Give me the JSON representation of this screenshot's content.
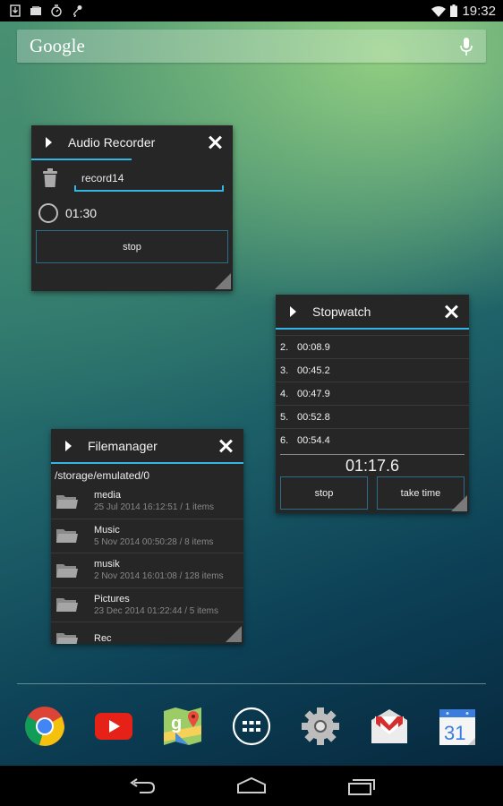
{
  "statusbar": {
    "left_icons": [
      "download-icon",
      "folder-icon",
      "stopwatch-icon",
      "microphone-icon"
    ],
    "right_icons": [
      "wifi-icon",
      "battery-icon"
    ],
    "time": "19:32"
  },
  "search": {
    "logo": "Google",
    "mic_icon": "microphone-icon"
  },
  "audio_recorder": {
    "title": "Audio Recorder",
    "filename": "record14",
    "elapsed": "01:30",
    "stop_label": "stop"
  },
  "stopwatch": {
    "title": "Stopwatch",
    "laps": [
      {
        "num": "2.",
        "time": "00:08.9"
      },
      {
        "num": "3.",
        "time": "00:45.2"
      },
      {
        "num": "4.",
        "time": "00:47.9"
      },
      {
        "num": "5.",
        "time": "00:52.8"
      },
      {
        "num": "6.",
        "time": "00:54.4"
      }
    ],
    "total": "01:17.6",
    "stop_label": "stop",
    "take_time_label": "take time"
  },
  "filemanager": {
    "title": "Filemanager",
    "path": "/storage/emulated/0",
    "items": [
      {
        "name": "media",
        "meta": "25 Jul 2014 16:12:51 / 1 items"
      },
      {
        "name": "Music",
        "meta": "5 Nov 2014 00:50:28 / 8 items"
      },
      {
        "name": "musik",
        "meta": "2 Nov 2014 16:01:08 / 128 items"
      },
      {
        "name": "Pictures",
        "meta": "23 Dec 2014 01:22:44 / 5 items"
      },
      {
        "name": "Rec",
        "meta": ""
      }
    ]
  },
  "dock": {
    "apps": [
      "chrome",
      "youtube",
      "maps",
      "app-drawer",
      "settings",
      "gmail",
      "calendar"
    ],
    "calendar_day": "31"
  },
  "navbar": {
    "buttons": [
      "back",
      "home",
      "recents"
    ]
  },
  "colors": {
    "accent": "#33b5e5",
    "window_bg": "#262626"
  }
}
